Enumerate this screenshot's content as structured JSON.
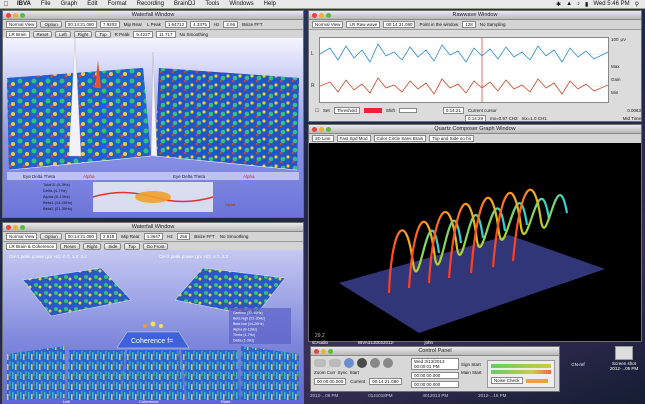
{
  "menubar": {
    "app": "IBVA",
    "items": [
      "File",
      "Graph",
      "Edit",
      "Format",
      "Recording",
      "BrainDJ",
      "Tools",
      "Windows",
      "Help"
    ],
    "clock": "Wed 5:46 PM"
  },
  "waterfall_top": {
    "title": "Waterfall Window",
    "view": "Normal View",
    "options_btn": "Option",
    "channel": "LR Brain",
    "time": "00:14:21.080",
    "value1": "7.9203",
    "unit1": "Mip Rear",
    "peak_label": "L Peak",
    "peak_value": "1.64712",
    "freq_value": "4.3375",
    "freq_unit": "Hz",
    "sr": "2.56",
    "sr_label": "Bsize FFT",
    "reset_btn": "Reset",
    "left_btn": "Left",
    "right_btn": "Right",
    "top_btn": "Top",
    "rpeak_label": "R Peak",
    "rpeak_value": "5.4227",
    "rfreq": "11.717",
    "smoothing": "No Smoothing",
    "bands": [
      "Eye Delta Theta",
      "Alpha",
      "Beta1",
      "Beta2"
    ],
    "rows": [
      "Total D (0-3Hz)",
      "Delta (4-7Hz)",
      "Alpha (8-13Hz)",
      "Beta1 (14-20Hz)",
      "Beta2 (21-30Hz)"
    ],
    "waveform_label": "Alpha",
    "freq_ticks": [
      "0",
      "2",
      "4",
      "6",
      "8",
      "10",
      "12",
      "14",
      "16",
      "18"
    ]
  },
  "waterfall_bottom": {
    "title": "Waterfall Window",
    "view": "Normal View",
    "options_btn": "Option",
    "channel": "LR Brain & Coherence",
    "time": "00:14:21.080",
    "value1": "2.918",
    "unit1": "Mip Rear",
    "peak_value": "4.3647",
    "freq_unit": "Hz",
    "sr": "256",
    "sr_label": "Bsize FFT",
    "reset_btn": "Reset",
    "right_btn": "Right",
    "left_btn": "Side",
    "top_btn": "Top",
    "zoom_btn": "Go Front",
    "smoothing": "No Smoothing",
    "left_header": "CH-1 peak power (µV Hz): 0.7, 1.2, 3.2",
    "right_header": "CH-2 peak power (µV Hz): 4.7, 2.3",
    "coherence_label": "Coherence f=",
    "legend": [
      "Gamma (31-40Hz)",
      "Beta high (21-30Hz)",
      "Beta low (14-20Hz)",
      "Alpha (8-13Hz)",
      "Theta (4-7Hz)",
      "Delta (1-3Hz)"
    ],
    "axis_labels": [
      "Left",
      "Coherence",
      "Right"
    ]
  },
  "raw": {
    "title": "Rawwave Window",
    "view": "Normal View",
    "mode": "LR Raw wave",
    "time": "00:14:31.080",
    "cursor_label": "Point in the window",
    "points": "128",
    "smoothing": "No Sampling",
    "channel_left": "L",
    "channel_right": "R",
    "scale_top": "100",
    "scale_unit": "µV",
    "side_labels": [
      "Max",
      "Gain",
      "Min"
    ],
    "bottom": {
      "set": "Set",
      "threshold": "Threshold",
      "shift": "Shift",
      "time1": "0:14:21",
      "time2": "0:14:29",
      "ch1": "Current cursor",
      "ch1b": "mx=1.0 CH1",
      "ch2": "mx=0.97 CH2",
      "sample": "Mid Time",
      "avg": "0.0063"
    }
  },
  "quartz": {
    "title": "Quartz Composer Graph Window",
    "line_mode": "2D Line",
    "speed": "Fast Spd Mod",
    "color": "Color Circle Sans Brain",
    "layout": "Top and Side no hit",
    "corner": "29.2"
  },
  "control_panel": {
    "title": "Control Panel",
    "start_time": "00:00:00.000",
    "current_label": "Current",
    "current_time": "00:14:21.080",
    "zoom_label": "Zoom Curr",
    "sync_label": "Sync",
    "start_label": "Start",
    "record_label": "Record",
    "play_label": "Play",
    "playhead_label": "Playback",
    "end_time": "00:20:35.7",
    "signal_label": "Signal",
    "rec_mode": "Mirr",
    "rec_date": "Wed 3/13/2013 00:00:01 PM",
    "sign_start": "Sign Start",
    "pre_label": "Main Start",
    "noise_check": "Noise Check",
    "val1": "00:00:00.000",
    "val2": "00:00:00.000"
  },
  "desktop": {
    "icon_name": "Screen shot",
    "icon_sub": "2012-...05 PM",
    "file1": "scAudio",
    "file2": "IBVA3130022012-",
    "file3": "john",
    "file4": "CN-ref",
    "dock": [
      "2012-...09 PM",
      "0141018PM",
      "4012013 PM",
      "2012-...15 PM"
    ]
  },
  "colors": {
    "plot_bg": "#8f96e6",
    "raw_left": "#2b8ecc",
    "raw_right": "#c74b2a",
    "accent": "#e2463d"
  }
}
